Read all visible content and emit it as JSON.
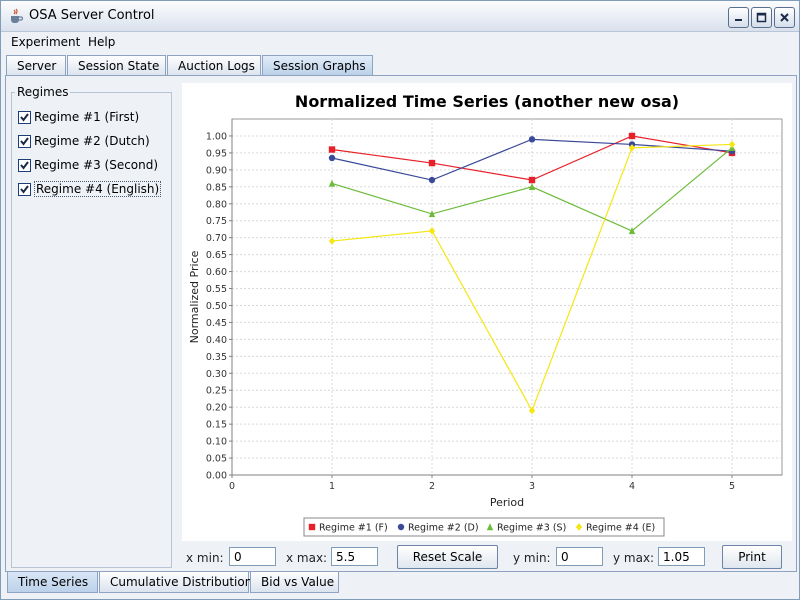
{
  "window": {
    "title": "OSA Server Control",
    "buttons": [
      "minimize",
      "maximize",
      "close"
    ]
  },
  "menu": {
    "items": [
      {
        "label": "Experiment",
        "mnemonic": "x"
      },
      {
        "label": "Help",
        "mnemonic": "H"
      }
    ]
  },
  "top_tabs": [
    {
      "label": "Server",
      "active": false
    },
    {
      "label": "Session State",
      "active": false
    },
    {
      "label": "Auction Logs",
      "active": false
    },
    {
      "label": "Session Graphs",
      "active": true
    }
  ],
  "regimes": {
    "title": "Regimes",
    "items": [
      {
        "label": "Regime #1 (First)",
        "checked": true
      },
      {
        "label": "Regime #2 (Dutch)",
        "checked": true
      },
      {
        "label": "Regime #3 (Second)",
        "checked": true
      },
      {
        "label": "Regime #4 (English)",
        "checked": true,
        "focused": true
      }
    ]
  },
  "controls": {
    "xmin_label": "x min:",
    "xmin_value": "0",
    "xmax_label": "x max:",
    "xmax_value": "5.5",
    "reset_label": "Reset Scale",
    "ymin_label": "y min:",
    "ymin_value": "0",
    "ymax_label": "y max:",
    "ymax_value": "1.05",
    "print_label": "Print"
  },
  "bottom_tabs": [
    {
      "label": "Time Series",
      "active": true
    },
    {
      "label": "Cumulative Distribution",
      "active": false
    },
    {
      "label": "Bid vs Value",
      "active": false
    }
  ],
  "chart_data": {
    "type": "line",
    "title": "Normalized Time Series (another new osa)",
    "xlabel": "Period",
    "ylabel": "Normalized Price",
    "xlim": [
      0,
      5.5
    ],
    "ylim": [
      0,
      1.05
    ],
    "xticks": [
      0,
      1,
      2,
      3,
      4,
      5
    ],
    "yticks": [
      0.0,
      0.05,
      0.1,
      0.15,
      0.2,
      0.25,
      0.3,
      0.35,
      0.4,
      0.45,
      0.5,
      0.55,
      0.6,
      0.65,
      0.7,
      0.75,
      0.8,
      0.85,
      0.9,
      0.95,
      1.0
    ],
    "grid": true,
    "legend_position": "bottom",
    "series": [
      {
        "name": "Regime #1 (F)",
        "color": "#e8202a",
        "marker": "square",
        "x": [
          1,
          2,
          3,
          4,
          5
        ],
        "y": [
          0.96,
          0.92,
          0.87,
          1.0,
          0.95
        ]
      },
      {
        "name": "Regime #2 (D)",
        "color": "#3a4a99",
        "marker": "circle",
        "x": [
          1,
          2,
          3,
          4,
          5
        ],
        "y": [
          0.935,
          0.87,
          0.99,
          0.975,
          0.955
        ]
      },
      {
        "name": "Regime #3 (S)",
        "color": "#6dbb3b",
        "marker": "triangle",
        "x": [
          1,
          2,
          3,
          4,
          5
        ],
        "y": [
          0.86,
          0.77,
          0.85,
          0.72,
          0.965
        ]
      },
      {
        "name": "Regime #4 (E)",
        "color": "#f5e614",
        "marker": "diamond",
        "x": [
          1,
          2,
          3,
          4,
          5
        ],
        "y": [
          0.69,
          0.72,
          0.19,
          0.965,
          0.975
        ]
      }
    ]
  }
}
